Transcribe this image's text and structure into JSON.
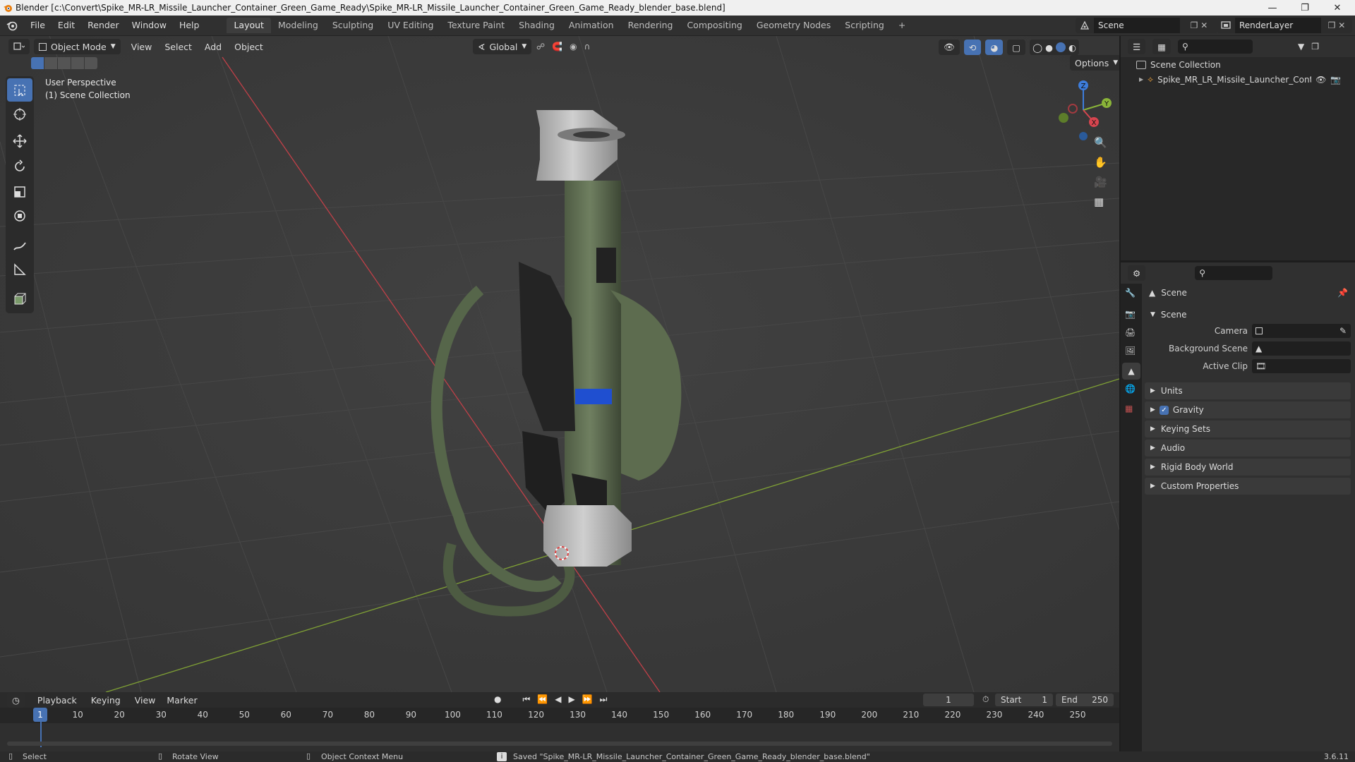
{
  "titlebar": {
    "title": "Blender [c:\\Convert\\Spike_MR-LR_Missile_Launcher_Container_Green_Game_Ready\\Spike_MR-LR_Missile_Launcher_Container_Green_Game_Ready_blender_base.blend]"
  },
  "menus": [
    "File",
    "Edit",
    "Render",
    "Window",
    "Help"
  ],
  "workspaces": [
    "Layout",
    "Modeling",
    "Sculpting",
    "UV Editing",
    "Texture Paint",
    "Shading",
    "Animation",
    "Rendering",
    "Compositing",
    "Geometry Nodes",
    "Scripting",
    "+"
  ],
  "active_workspace": "Layout",
  "scene_selector": "Scene",
  "renderlayer_selector": "RenderLayer",
  "viewport": {
    "mode": "Object Mode",
    "menus": [
      "View",
      "Select",
      "Add",
      "Object"
    ],
    "transform_orientation": "Global",
    "options_label": "Options",
    "overlay_line1": "User Perspective",
    "overlay_line2": "(1) Scene Collection",
    "gizmo": {
      "z": "Z",
      "y": "Y",
      "x": "X"
    }
  },
  "outliner": {
    "root": "Scene Collection",
    "items": [
      {
        "label": "Spike_MR_LR_Missile_Launcher_Contair"
      }
    ]
  },
  "properties": {
    "header": "Scene",
    "section": "Scene",
    "fields": [
      {
        "label": "Camera"
      },
      {
        "label": "Background Scene"
      },
      {
        "label": "Active Clip"
      }
    ],
    "panels": [
      "Units",
      "Gravity",
      "Keying Sets",
      "Audio",
      "Rigid Body World",
      "Custom Properties"
    ],
    "gravity_checked": true
  },
  "timeline": {
    "menus": [
      "Playback",
      "Keying",
      "View",
      "Marker"
    ],
    "current_frame": "1",
    "start_label": "Start",
    "start": "1",
    "end_label": "End",
    "end": "250",
    "ticks": [
      "1",
      "10",
      "20",
      "30",
      "40",
      "50",
      "60",
      "70",
      "80",
      "90",
      "100",
      "110",
      "120",
      "130",
      "140",
      "150",
      "160",
      "170",
      "180",
      "190",
      "200",
      "210",
      "220",
      "230",
      "240",
      "250"
    ]
  },
  "statusbar": {
    "select": "Select",
    "rotate": "Rotate View",
    "context": "Object Context Menu",
    "message": "Saved \"Spike_MR-LR_Missile_Launcher_Container_Green_Game_Ready_blender_base.blend\"",
    "version": "3.6.11"
  },
  "colors": {
    "accent": "#4772b3",
    "x_axis": "#d6454f",
    "y_axis": "#8ab439",
    "z_axis": "#3d7ddc",
    "viewport_bg": "#3a3a3a"
  }
}
